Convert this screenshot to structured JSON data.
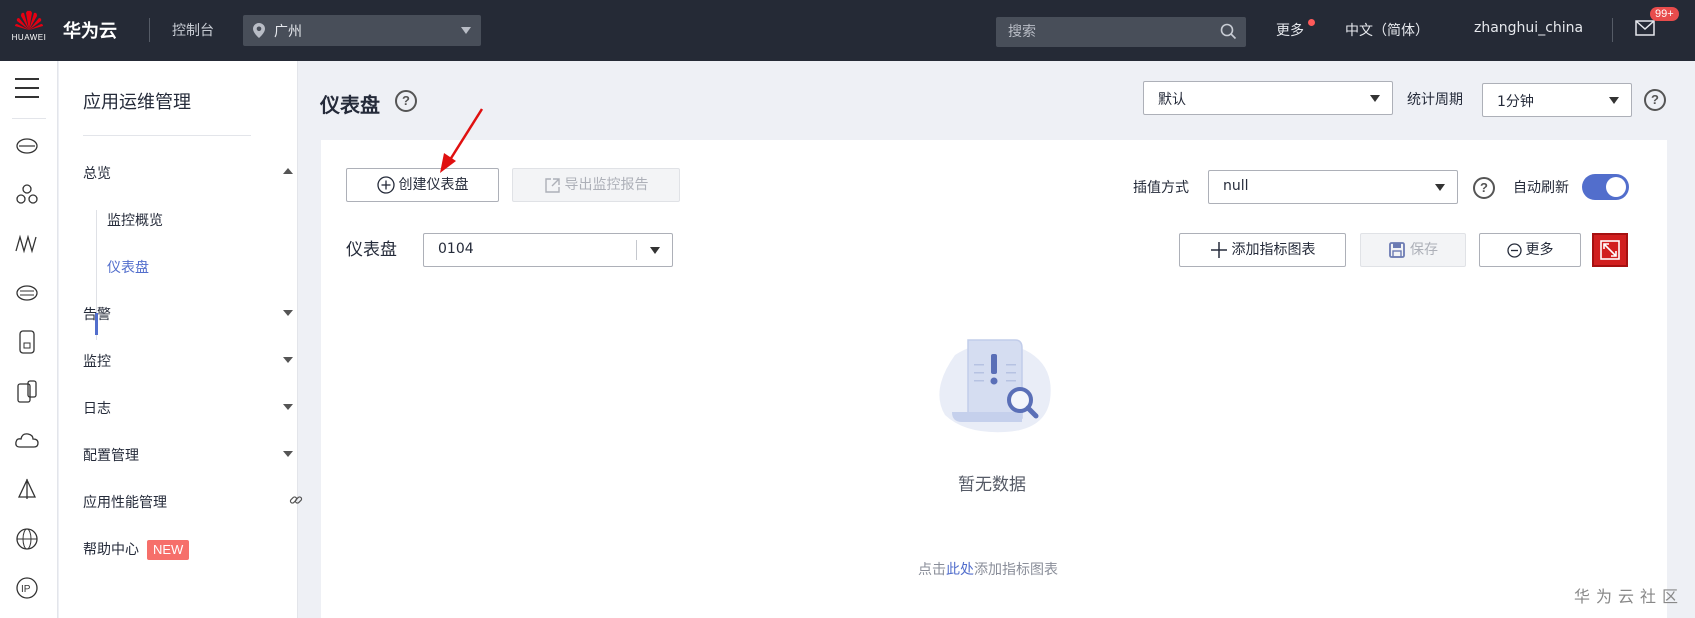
{
  "topbar": {
    "logo_text": "HUAWEI",
    "brand": "华为云",
    "console": "控制台",
    "region": "广州",
    "search_placeholder": "搜索",
    "more": "更多",
    "language": "中文（简体）",
    "username": "zhanghui_china",
    "mail_badge": "99+"
  },
  "rail": {
    "icons": [
      "cloud-server-icon",
      "network-icon",
      "monitor-wave-icon",
      "storage-icon",
      "database-icon",
      "device-icon",
      "cloud-icon",
      "sail-icon",
      "globe-icon",
      "ip-icon"
    ]
  },
  "sidebar": {
    "title": "应用运维管理",
    "items": [
      {
        "label": "总览"
      },
      {
        "label": "告警"
      },
      {
        "label": "监控"
      },
      {
        "label": "日志"
      },
      {
        "label": "配置管理"
      },
      {
        "label": "应用性能管理"
      },
      {
        "label": "帮助中心",
        "badge": "NEW"
      }
    ],
    "sub_items": [
      {
        "label": "监控概览"
      },
      {
        "label": "仪表盘",
        "active": true
      }
    ]
  },
  "header": {
    "title": "仪表盘",
    "default_select": "默认",
    "period_label": "统计周期",
    "period_select": "1分钟"
  },
  "panel": {
    "create_button": "创建仪表盘",
    "export_button": "导出监控报告",
    "interpolation_label": "插值方式",
    "interpolation_value": "null",
    "auto_refresh_label": "自动刷新",
    "auto_refresh_on": true,
    "dashboard_label": "仪表盘",
    "dashboard_value": "0104",
    "add_chart_button": "添加指标图表",
    "save_button": "保存",
    "more_button": "更多",
    "empty_text": "暂无数据",
    "hint_prefix": "点击",
    "hint_link": "此处",
    "hint_suffix": "添加指标图表"
  },
  "watermark": "华为云社区",
  "colors": {
    "topbar": "#252a36",
    "accent": "#526ecc",
    "fullscreen": "#d11f1f",
    "new_badge": "#f66f6a"
  }
}
